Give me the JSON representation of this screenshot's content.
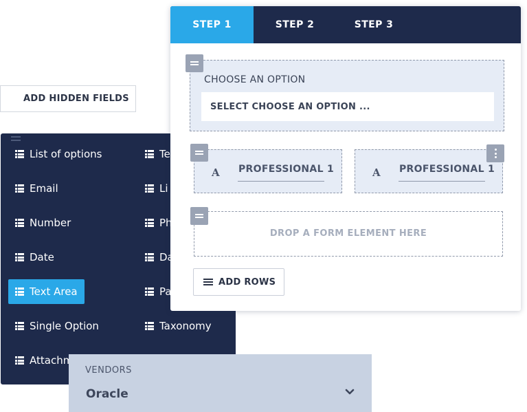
{
  "hidden_fields": {
    "label": "ADD HIDDEN FIELDS"
  },
  "field_panel": {
    "left_column": [
      {
        "label": "List of options",
        "icon": "list-icon"
      },
      {
        "label": "Email",
        "icon": "list-icon"
      },
      {
        "label": "Number",
        "icon": "list-icon"
      },
      {
        "label": "Date",
        "icon": "list-icon"
      },
      {
        "label": "Text Area",
        "icon": "list-icon",
        "active": true
      },
      {
        "label": "Single Option",
        "icon": "list-icon"
      },
      {
        "label": "Attachm",
        "icon": "list-icon"
      }
    ],
    "right_column": [
      {
        "label": "Te",
        "icon": "list-icon"
      },
      {
        "label": "Li",
        "icon": "list-icon"
      },
      {
        "label": "Ph",
        "icon": "list-icon"
      },
      {
        "label": "Da",
        "icon": "list-icon"
      },
      {
        "label": "Pa",
        "icon": "list-icon"
      },
      {
        "label": "Taxonomy",
        "icon": "list-icon"
      }
    ]
  },
  "vendors": {
    "label": "VENDORS",
    "value": "Oracle",
    "icon": "chevron-down-icon"
  },
  "tabs": [
    {
      "label": "STEP 1",
      "active": true
    },
    {
      "label": "STEP 2",
      "active": false
    },
    {
      "label": "STEP 3",
      "active": false
    }
  ],
  "form": {
    "choose_label": "CHOOSE AN OPTION",
    "select_value": "SELECT CHOOSE AN OPTION ...",
    "field_a": {
      "icon_text": "A",
      "label": "PROFESSIONAL 1"
    },
    "field_b": {
      "icon_text": "A",
      "label": "PROFESSIONAL 1"
    },
    "drop_text": "DROP A FORM ELEMENT HERE",
    "add_rows": "ADD ROWS"
  },
  "colors": {
    "navy": "#1e2a4b",
    "accent": "#2aa8e8",
    "vendors_bg": "#c8d2e2",
    "row_bg": "#e6ecf6"
  }
}
